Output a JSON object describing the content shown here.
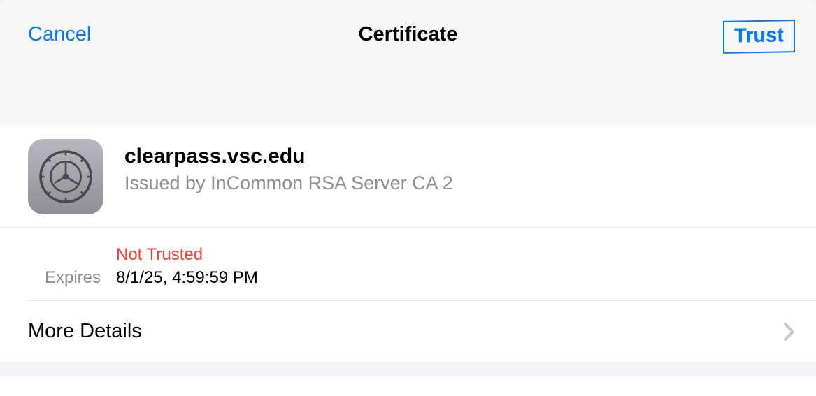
{
  "nav": {
    "cancel": "Cancel",
    "title": "Certificate",
    "trust": "Trust"
  },
  "certificate": {
    "common_name": "clearpass.vsc.edu",
    "issued_by": "Issued by InCommon RSA Server CA 2",
    "trust_status": "Not Trusted",
    "expires_label": "Expires",
    "expires_value": "8/1/25, 4:59:59 PM"
  },
  "more_details": {
    "label": "More Details"
  },
  "colors": {
    "accent": "#007aff",
    "danger": "#ff3b30",
    "secondary": "#8e8e93"
  }
}
